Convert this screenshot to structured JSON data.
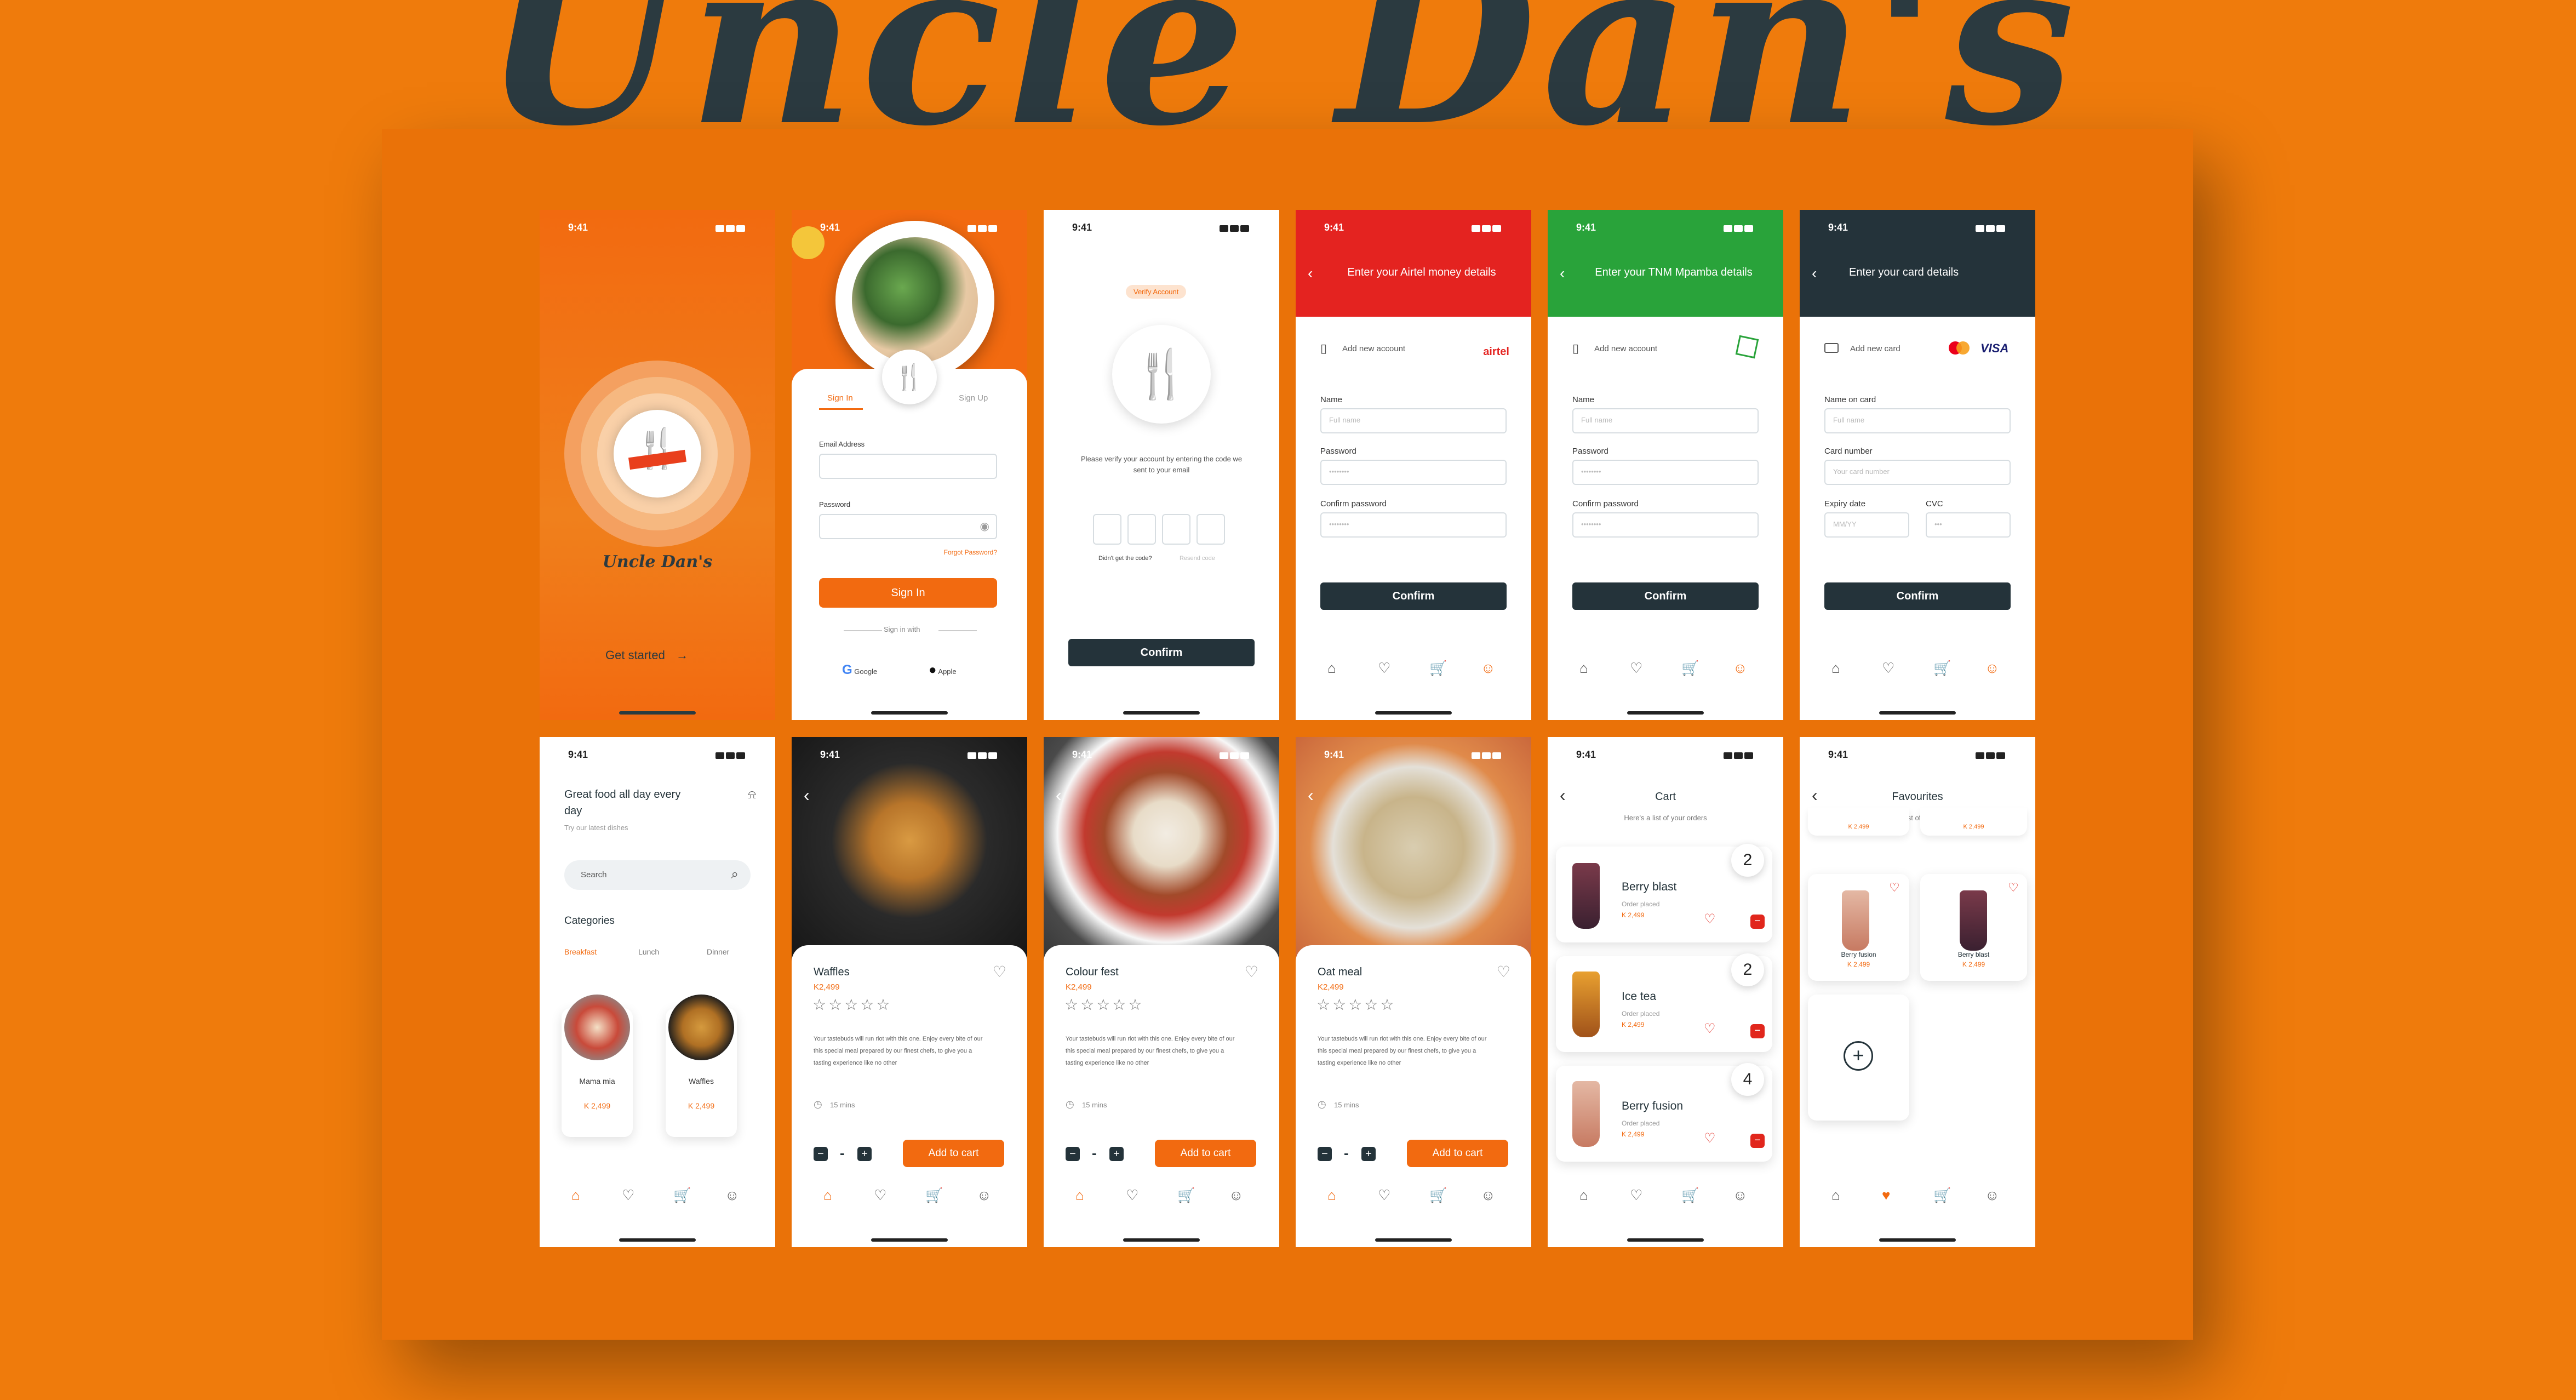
{
  "brand": {
    "title": "Uncle Dan's",
    "logo_text": "Uncle Dan's",
    "accent": "#f26a10",
    "dark": "#24333a",
    "airtel_red": "#e42320",
    "tnm_green": "#29a33a"
  },
  "status": {
    "time": "9:41"
  },
  "splash": {
    "cta": "Get started"
  },
  "signin": {
    "tab_signin": "Sign In",
    "tab_signup": "Sign Up",
    "email_label": "Email Address",
    "password_label": "Password",
    "forgot": "Forgot Password?",
    "button": "Sign In",
    "divider": "Sign in with",
    "google": "Google",
    "apple": "Apple"
  },
  "verify": {
    "badge": "Verify Account",
    "text": "Please verify your account by entering the code we sent to your email",
    "resend_q": "Didn't get the code?",
    "resend": "Resend code",
    "button": "Confirm"
  },
  "airtel": {
    "title": "Enter your Airtel money details",
    "add": "Add new account",
    "brand": "airtel",
    "name_label": "Name",
    "name_ph": "Full name",
    "pass_label": "Password",
    "pass_ph": "••••••••",
    "confirm_label": "Confirm password",
    "confirm_ph": "••••••••",
    "button": "Confirm"
  },
  "tnm": {
    "title": "Enter your TNM Mpamba details",
    "add": "Add new account",
    "name_label": "Name",
    "name_ph": "Full name",
    "pass_label": "Password",
    "pass_ph": "••••••••",
    "confirm_label": "Confirm password",
    "confirm_ph": "••••••••",
    "button": "Confirm"
  },
  "card": {
    "title": "Enter your card details",
    "add": "Add new card",
    "visa": "VISA",
    "name_label": "Name on card",
    "name_ph": "Full name",
    "number_label": "Card number",
    "number_ph": "Your card number",
    "expiry_label": "Expiry date",
    "expiry_ph": "MM/YY",
    "cvc_label": "CVC",
    "cvc_ph": "•••",
    "button": "Confirm"
  },
  "home": {
    "greeting": "Great food all day every day",
    "sub": "Try our latest dishes",
    "search_ph": "Search",
    "categories": "Categories",
    "cats": [
      "Breakfast",
      "Lunch",
      "Dinner"
    ],
    "items": [
      {
        "name": "Mama mia",
        "price": "K 2,499"
      },
      {
        "name": "Waffles",
        "price": "K 2,499"
      }
    ]
  },
  "details": [
    {
      "name": "Waffles",
      "price": "K2,499",
      "desc": "Your tastebuds will run riot with this one. Enjoy every bite of our this special meal prepared by our finest chefs, to give you a tasting experience like no other",
      "time": "15 mins",
      "qty": "-",
      "cta": "Add to cart"
    },
    {
      "name": "Colour fest",
      "price": "K2,499",
      "desc": "Your tastebuds will run riot with this one. Enjoy every bite of our this special meal prepared by our finest chefs, to give you a tasting experience like no other",
      "time": "15 mins",
      "qty": "-",
      "cta": "Add to cart"
    },
    {
      "name": "Oat meal",
      "price": "K2,499",
      "desc": "Your tastebuds will run riot with this one. Enjoy every bite of our this special meal prepared by our finest chefs, to give you a tasting experience like no other",
      "time": "15 mins",
      "qty": "-",
      "cta": "Add to cart"
    }
  ],
  "cart": {
    "title": "Cart",
    "sub": "Here's a list of your orders",
    "items": [
      {
        "name": "Berry blast",
        "status": "Order placed",
        "price": "K 2,499",
        "count": "2"
      },
      {
        "name": "Ice tea",
        "status": "Order placed",
        "price": "K 2,499",
        "count": "2"
      },
      {
        "name": "Berry fusion",
        "status": "Order placed",
        "price": "K 2,499",
        "count": "4"
      }
    ]
  },
  "favs": {
    "title": "Favourites",
    "sub": "Here's a list of your orders",
    "top_price": "K 2,499",
    "items": [
      {
        "name": "Berry fusion",
        "price": "K 2,499"
      },
      {
        "name": "Berry blast",
        "price": "K 2,499"
      }
    ]
  }
}
